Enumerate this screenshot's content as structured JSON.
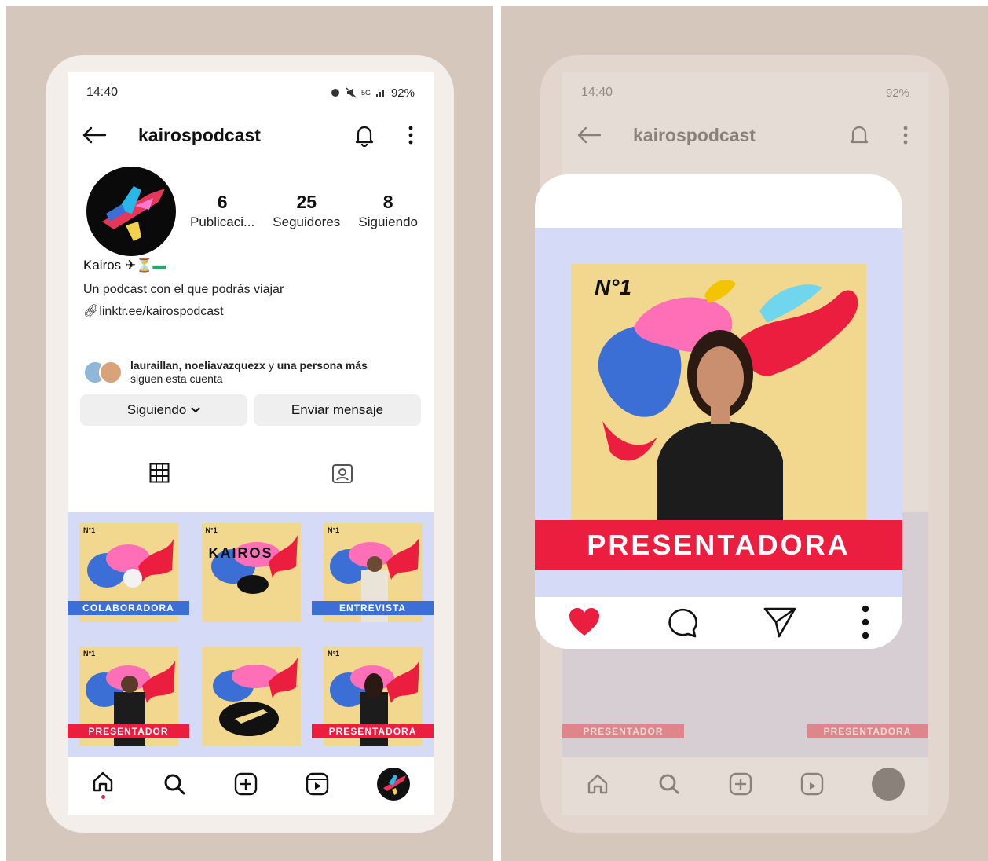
{
  "status": {
    "time": "14:40",
    "network": "5G",
    "battery": "92%"
  },
  "header": {
    "username": "kairospodcast"
  },
  "profile": {
    "name": "Kairos",
    "bio": "Un podcast con el que podrás viajar",
    "link": "linktr.ee/kairospodcast",
    "stats": [
      {
        "value": "6",
        "label": "Publicaci..."
      },
      {
        "value": "25",
        "label": "Seguidores"
      },
      {
        "value": "8",
        "label": "Siguiendo"
      }
    ],
    "followed_by_names": "lauraillan, noeliavazquezx",
    "followed_by_mid": " y ",
    "followed_by_more": "una persona más",
    "followed_by_line2": "siguen esta cuenta"
  },
  "buttons": {
    "following": "Siguiendo",
    "message": "Enviar mensaje"
  },
  "posts": [
    {
      "banner": "COLABORADORA",
      "banner_color": "#3b6fd6",
      "badge": "N°1"
    },
    {
      "banner": "",
      "banner_color": "",
      "badge": "N°1",
      "title": "KAIROS"
    },
    {
      "banner": "ENTREVISTA",
      "banner_color": "#3b6fd6",
      "badge": "N°1"
    },
    {
      "banner": "PRESENTADOR",
      "banner_color": "#ec1e3f",
      "badge": "N°1"
    },
    {
      "banner": "",
      "banner_color": "",
      "badge": ""
    },
    {
      "banner": "PRESENTADORA",
      "banner_color": "#ec1e3f",
      "badge": "N°1"
    }
  ],
  "preview": {
    "badge": "N°1",
    "banner": "PRESENTADORA"
  },
  "colors": {
    "accent_red": "#ec1e3f",
    "accent_blue": "#3b6fd6",
    "post_bg": "#d5dbf7",
    "post_square": "#f2d88f",
    "panel_bg": "#d6c7bd"
  },
  "icons": [
    "back-arrow-icon",
    "bell-icon",
    "more-vertical-icon",
    "link-icon",
    "grid-icon",
    "tagged-icon",
    "home-icon",
    "search-icon",
    "add-icon",
    "reels-icon",
    "heart-icon",
    "comment-icon",
    "share-icon"
  ]
}
